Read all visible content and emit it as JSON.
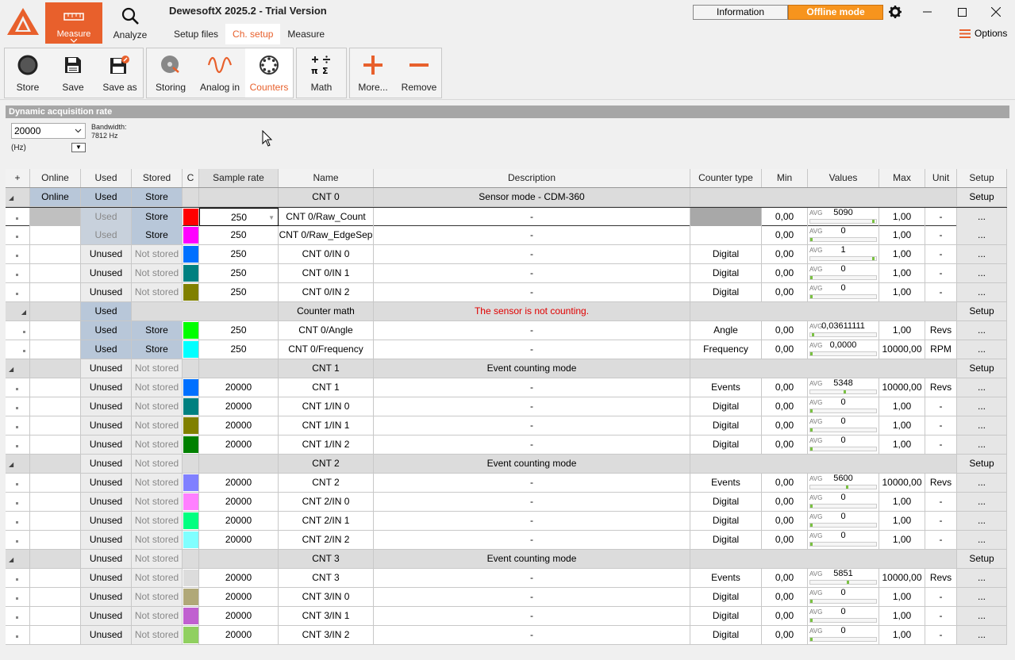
{
  "app": {
    "title": "DewesoftX 2025.2 - Trial Version"
  },
  "modes": {
    "measure": "Measure",
    "analyze": "Analyze"
  },
  "subtabs": [
    "Setup files",
    "Ch. setup",
    "Measure"
  ],
  "topbar": {
    "information": "Information",
    "offline": "Offline mode",
    "options": "Options"
  },
  "ribbon": {
    "store": "Store",
    "save": "Save",
    "save_as": "Save as",
    "storing": "Storing",
    "analog_in": "Analog in",
    "counters": "Counters",
    "math": "Math",
    "more": "More...",
    "remove": "Remove"
  },
  "acq": {
    "header": "Dynamic acquisition rate",
    "rate": "20000",
    "bandwidth_label": "Bandwidth:",
    "bandwidth_value": "7812 Hz",
    "unit": "(Hz)"
  },
  "columns": [
    "+",
    "Online",
    "Used",
    "Stored",
    "C",
    "Sample rate",
    "Name",
    "Description",
    "Counter type",
    "Min",
    "Values",
    "Max",
    "Unit",
    "Setup"
  ],
  "rows": [
    {
      "kind": "group",
      "online": "Online",
      "used": "Used",
      "stored": "Store",
      "name": "CNT 0",
      "desc": "Sensor mode - CDM-360",
      "setup": "Setup"
    },
    {
      "kind": "ch",
      "used": "Used",
      "stored": "Store",
      "color": "#ff0000",
      "rate": "250",
      "name": "CNT 0/Raw_Count",
      "desc": "-",
      "ctype": "",
      "min": "0,00",
      "value": "5090",
      "fill": 0.98,
      "max": "1,00",
      "unit": "-",
      "setup": "...",
      "sel": true
    },
    {
      "kind": "ch",
      "used": "Used",
      "stored": "Store",
      "color": "#ff00ff",
      "rate": "250",
      "name": "CNT 0/Raw_EdgeSep",
      "desc": "-",
      "ctype": "",
      "min": "0,00",
      "value": "0",
      "fill": 0,
      "max": "1,00",
      "unit": "-",
      "setup": "..."
    },
    {
      "kind": "ch",
      "used": "Unused",
      "stored": "Not stored",
      "color": "#0070ff",
      "rate": "250",
      "name": "CNT 0/IN 0",
      "desc": "-",
      "ctype": "Digital",
      "min": "0,00",
      "value": "1",
      "fill": 0.98,
      "max": "1,00",
      "unit": "-",
      "setup": "..."
    },
    {
      "kind": "ch",
      "used": "Unused",
      "stored": "Not stored",
      "color": "#008080",
      "rate": "250",
      "name": "CNT 0/IN 1",
      "desc": "-",
      "ctype": "Digital",
      "min": "0,00",
      "value": "0",
      "fill": 0,
      "max": "1,00",
      "unit": "-",
      "setup": "..."
    },
    {
      "kind": "ch",
      "used": "Unused",
      "stored": "Not stored",
      "color": "#808000",
      "rate": "250",
      "name": "CNT 0/IN 2",
      "desc": "-",
      "ctype": "Digital",
      "min": "0,00",
      "value": "0",
      "fill": 0,
      "max": "1,00",
      "unit": "-",
      "setup": "..."
    },
    {
      "kind": "subgroup",
      "used": "Used",
      "name": "Counter math",
      "desc": "The sensor is not counting.",
      "setup": "Setup"
    },
    {
      "kind": "sub",
      "used": "Used",
      "stored": "Store",
      "color": "#00ff00",
      "rate": "250",
      "name": "CNT 0/Angle",
      "desc": "-",
      "ctype": "Angle",
      "min": "0,00",
      "value": "0,03611111",
      "fill": 0.02,
      "max": "1,00",
      "unit": "Revs",
      "setup": "..."
    },
    {
      "kind": "sub",
      "used": "Used",
      "stored": "Store",
      "color": "#00ffff",
      "rate": "250",
      "name": "CNT 0/Frequency",
      "desc": "-",
      "ctype": "Frequency",
      "min": "0,00",
      "value": "0,0000",
      "fill": 0,
      "max": "10000,00",
      "unit": "RPM",
      "setup": "..."
    },
    {
      "kind": "group",
      "online": "",
      "used": "Unused",
      "stored": "Not stored",
      "name": "CNT 1",
      "desc": "Event counting mode",
      "setup": "Setup"
    },
    {
      "kind": "ch",
      "used": "Unused",
      "stored": "Not stored",
      "color": "#0070ff",
      "rate": "20000",
      "name": "CNT 1",
      "desc": "-",
      "ctype": "Events",
      "min": "0,00",
      "value": "5348",
      "fill": 0.53,
      "max": "10000,00",
      "unit": "Revs",
      "setup": "..."
    },
    {
      "kind": "ch",
      "used": "Unused",
      "stored": "Not stored",
      "color": "#008080",
      "rate": "20000",
      "name": "CNT 1/IN 0",
      "desc": "-",
      "ctype": "Digital",
      "min": "0,00",
      "value": "0",
      "fill": 0,
      "max": "1,00",
      "unit": "-",
      "setup": "..."
    },
    {
      "kind": "ch",
      "used": "Unused",
      "stored": "Not stored",
      "color": "#808000",
      "rate": "20000",
      "name": "CNT 1/IN 1",
      "desc": "-",
      "ctype": "Digital",
      "min": "0,00",
      "value": "0",
      "fill": 0,
      "max": "1,00",
      "unit": "-",
      "setup": "..."
    },
    {
      "kind": "ch",
      "used": "Unused",
      "stored": "Not stored",
      "color": "#008000",
      "rate": "20000",
      "name": "CNT 1/IN 2",
      "desc": "-",
      "ctype": "Digital",
      "min": "0,00",
      "value": "0",
      "fill": 0,
      "max": "1,00",
      "unit": "-",
      "setup": "..."
    },
    {
      "kind": "group",
      "online": "",
      "used": "Unused",
      "stored": "Not stored",
      "name": "CNT 2",
      "desc": "Event counting mode",
      "setup": "Setup"
    },
    {
      "kind": "ch",
      "used": "Unused",
      "stored": "Not stored",
      "color": "#8080ff",
      "rate": "20000",
      "name": "CNT 2",
      "desc": "-",
      "ctype": "Events",
      "min": "0,00",
      "value": "5600",
      "fill": 0.56,
      "max": "10000,00",
      "unit": "Revs",
      "setup": "..."
    },
    {
      "kind": "ch",
      "used": "Unused",
      "stored": "Not stored",
      "color": "#ff80ff",
      "rate": "20000",
      "name": "CNT 2/IN 0",
      "desc": "-",
      "ctype": "Digital",
      "min": "0,00",
      "value": "0",
      "fill": 0,
      "max": "1,00",
      "unit": "-",
      "setup": "..."
    },
    {
      "kind": "ch",
      "used": "Unused",
      "stored": "Not stored",
      "color": "#00ff80",
      "rate": "20000",
      "name": "CNT 2/IN 1",
      "desc": "-",
      "ctype": "Digital",
      "min": "0,00",
      "value": "0",
      "fill": 0,
      "max": "1,00",
      "unit": "-",
      "setup": "..."
    },
    {
      "kind": "ch",
      "used": "Unused",
      "stored": "Not stored",
      "color": "#80ffff",
      "rate": "20000",
      "name": "CNT 2/IN 2",
      "desc": "-",
      "ctype": "Digital",
      "min": "0,00",
      "value": "0",
      "fill": 0,
      "max": "1,00",
      "unit": "-",
      "setup": "..."
    },
    {
      "kind": "group",
      "online": "",
      "used": "Unused",
      "stored": "Not stored",
      "name": "CNT 3",
      "desc": "Event counting mode",
      "setup": "Setup"
    },
    {
      "kind": "ch",
      "used": "Unused",
      "stored": "Not stored",
      "color": "#dcdcdc",
      "rate": "20000",
      "name": "CNT 3",
      "desc": "-",
      "ctype": "Events",
      "min": "0,00",
      "value": "5851",
      "fill": 0.58,
      "max": "10000,00",
      "unit": "Revs",
      "setup": "..."
    },
    {
      "kind": "ch",
      "used": "Unused",
      "stored": "Not stored",
      "color": "#b0a878",
      "rate": "20000",
      "name": "CNT 3/IN 0",
      "desc": "-",
      "ctype": "Digital",
      "min": "0,00",
      "value": "0",
      "fill": 0,
      "max": "1,00",
      "unit": "-",
      "setup": "..."
    },
    {
      "kind": "ch",
      "used": "Unused",
      "stored": "Not stored",
      "color": "#c060d0",
      "rate": "20000",
      "name": "CNT 3/IN 1",
      "desc": "-",
      "ctype": "Digital",
      "min": "0,00",
      "value": "0",
      "fill": 0,
      "max": "1,00",
      "unit": "-",
      "setup": "..."
    },
    {
      "kind": "ch",
      "used": "Unused",
      "stored": "Not stored",
      "color": "#90d060",
      "rate": "20000",
      "name": "CNT 3/IN 2",
      "desc": "-",
      "ctype": "Digital",
      "min": "0,00",
      "value": "0",
      "fill": 0,
      "max": "1,00",
      "unit": "-",
      "setup": "..."
    }
  ],
  "value_label": "AVG",
  "colors": {
    "accent": "#e8602c",
    "offline": "#f7941d",
    "used": "#b8c7d9",
    "bar": "#7ac142",
    "error": "#e00000"
  },
  "icons": [
    "dewesoft-logo-icon",
    "ruler-icon",
    "chevron-down-icon",
    "search-icon",
    "gear-icon",
    "minimize-icon",
    "maximize-icon",
    "close-icon",
    "hamburger-icon",
    "record-icon",
    "save-icon",
    "save-as-icon",
    "storing-icon",
    "analog-in-icon",
    "counters-icon",
    "math-icon",
    "plus-icon",
    "minus-icon",
    "cursor-icon"
  ]
}
